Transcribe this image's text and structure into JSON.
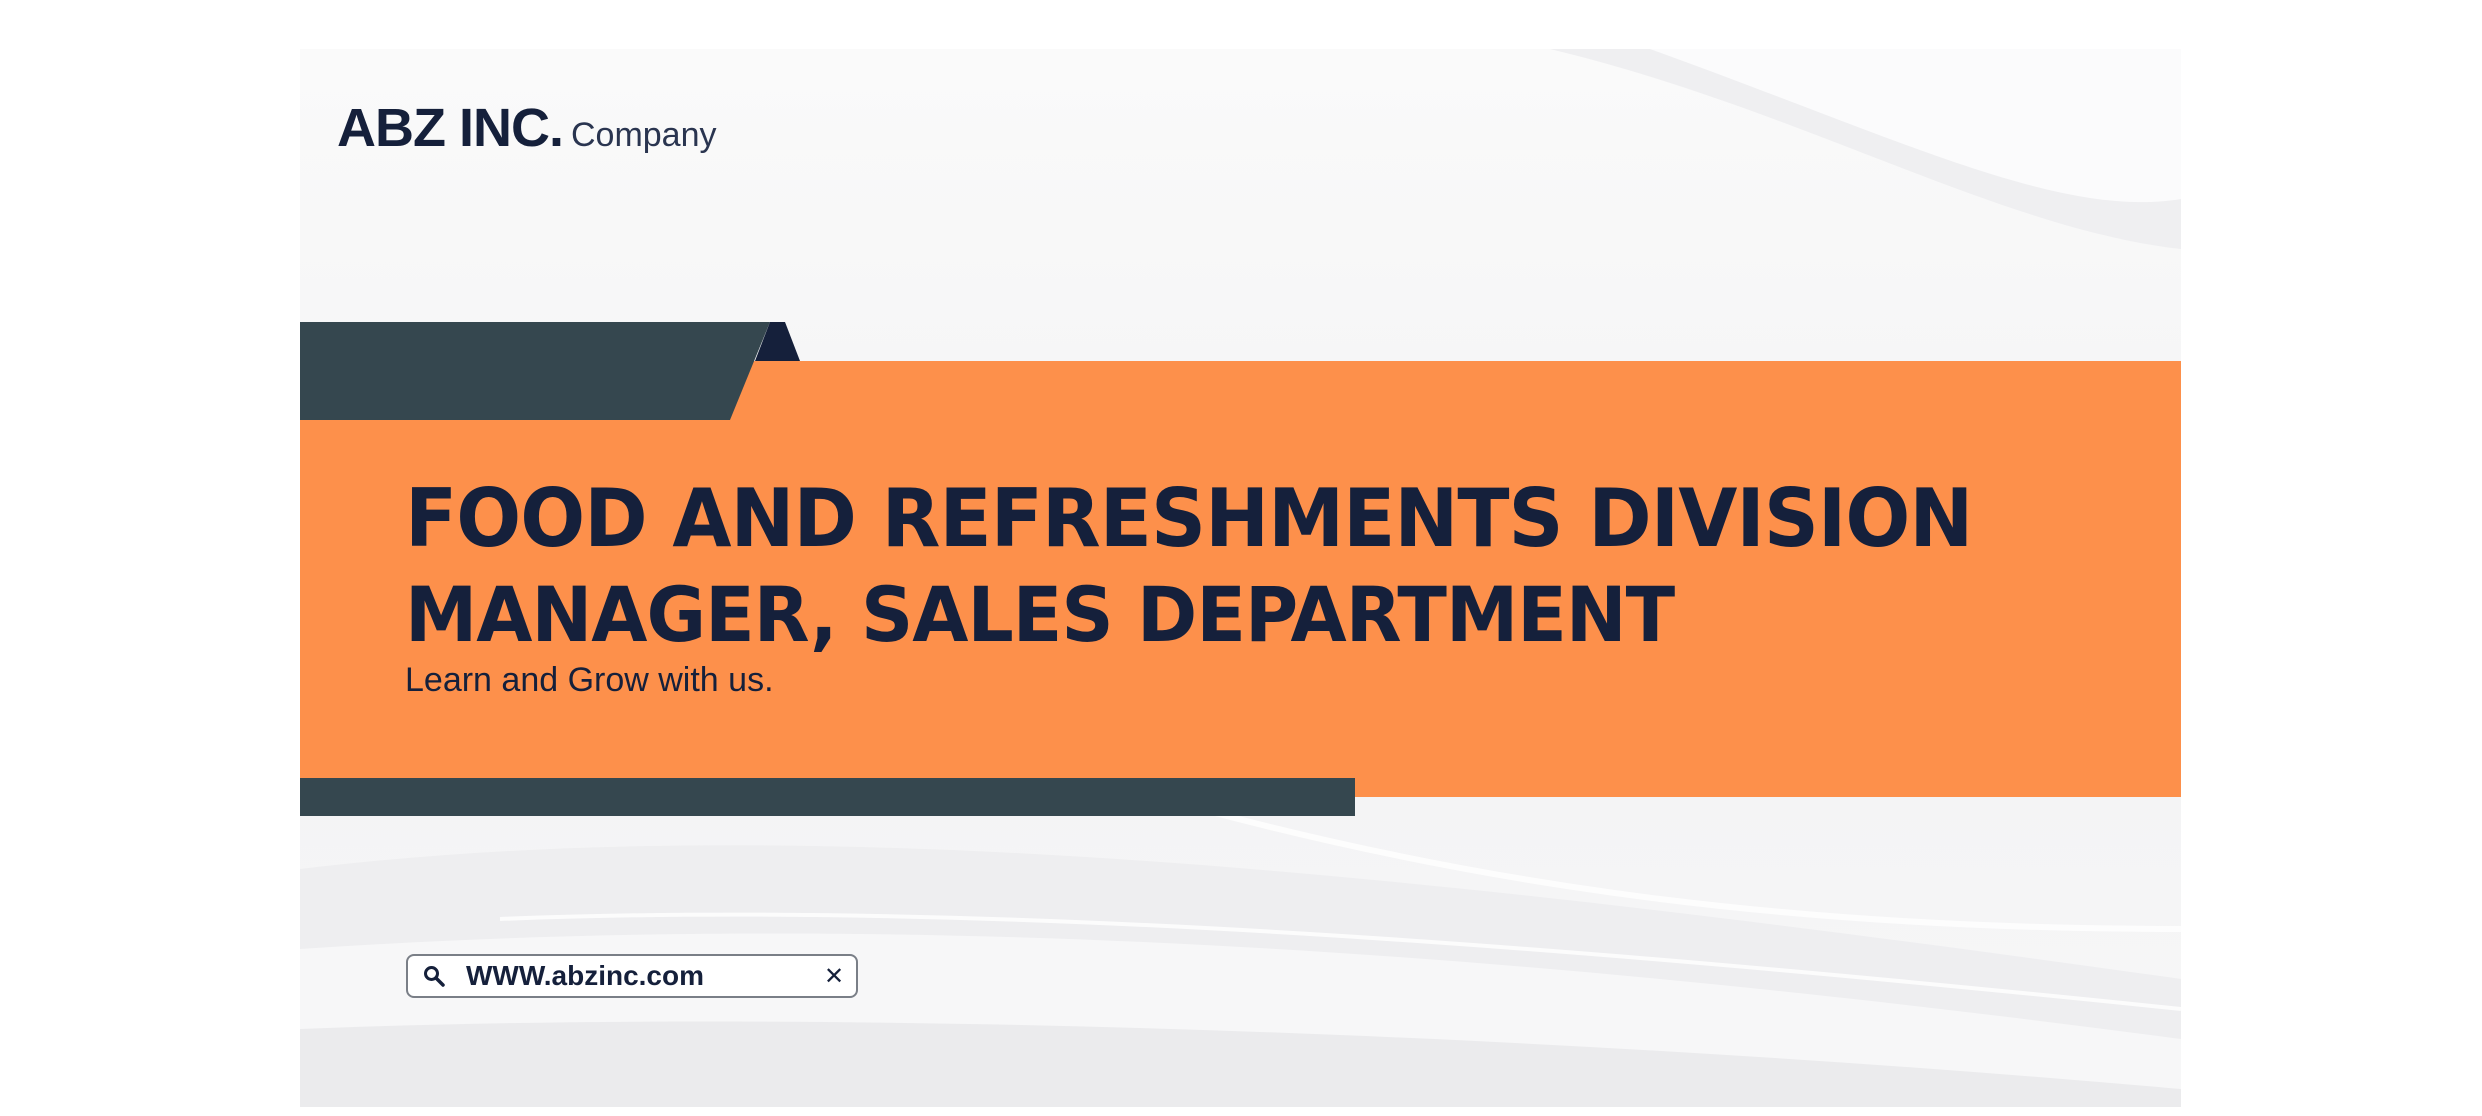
{
  "brand": {
    "name": "ABZ INC.",
    "sub": "Company"
  },
  "headline": {
    "line1": "FOOD AND REFRESHMENTS DIVISION",
    "line2": "MANAGER, SALES DEPARTMENT"
  },
  "tagline": "Learn and Grow with us.",
  "url_bar": {
    "text": "WWW.abzinc.com",
    "left_icon": "search-icon",
    "right_icon": "close-icon",
    "close_glyph": "✕"
  },
  "colors": {
    "orange": "#fd904b",
    "slate": "#35474f",
    "navy": "#15203b",
    "background": "#f5f5f6"
  }
}
